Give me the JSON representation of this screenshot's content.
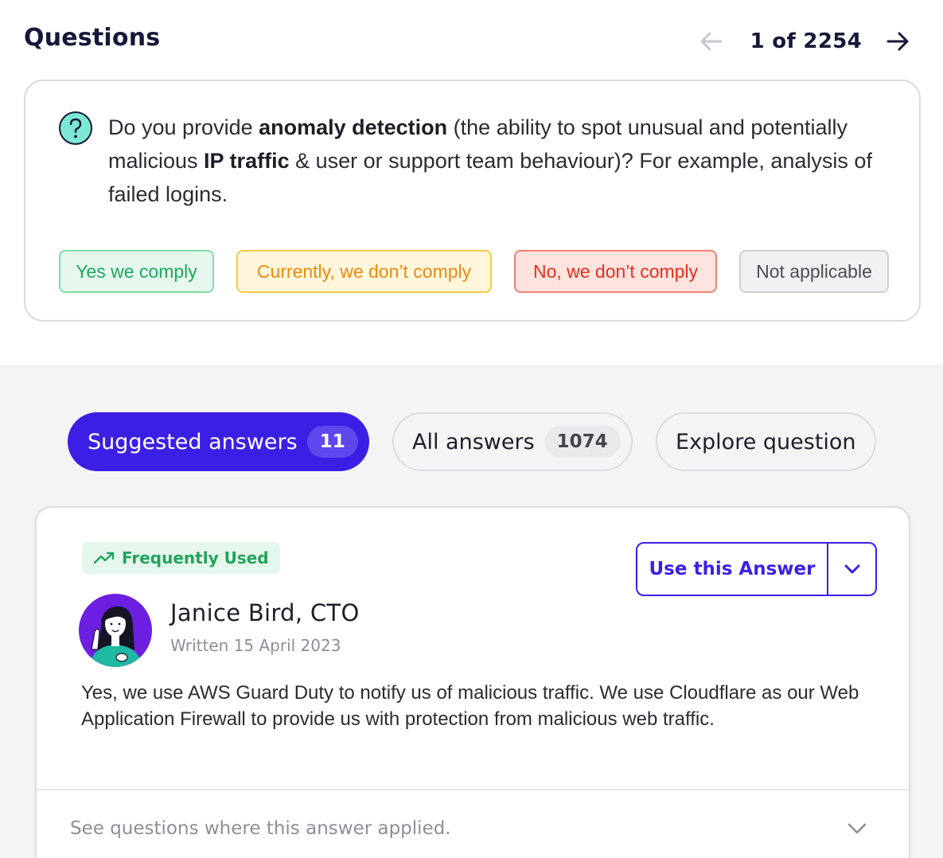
{
  "header": {
    "title": "Questions",
    "pager": {
      "current": 1,
      "total": 2254,
      "text": "1 of 2254"
    }
  },
  "question": {
    "segments": [
      {
        "text": "Do you provide ",
        "bold": false
      },
      {
        "text": "anomaly detection",
        "bold": true
      },
      {
        "text": " (the ability to spot unusual and potentially malicious ",
        "bold": false
      },
      {
        "text": "IP traffic",
        "bold": true
      },
      {
        "text": " & user or support team behaviour)? For example, analysis of failed logins.",
        "bold": false
      }
    ],
    "options": {
      "yes": "Yes we comply",
      "currently": "Currently, we don’t comply",
      "no": "No, we don’t comply",
      "na": "Not applicable"
    }
  },
  "tabs": {
    "suggested": {
      "label": "Suggested answers",
      "count": "11"
    },
    "all": {
      "label": "All answers",
      "count": "1074"
    },
    "explore": {
      "label": "Explore question"
    }
  },
  "answer_card": {
    "tag": "Frequently Used",
    "use_button": "Use this Answer",
    "author": "Janice Bird, CTO",
    "written": "Written 15 April 2023",
    "body": "Yes, we use AWS Guard Duty to notify us of malicious traffic. We use Cloudflare as our Web Application Firewall to provide us with protection from malicious web traffic.",
    "see_questions": "See questions where this answer applied."
  },
  "colors": {
    "brand": "#3c1fe5",
    "yes": "#1ea860",
    "currently": "#ea8a12",
    "no": "#e4301e",
    "neutral": "#4c4c56"
  }
}
